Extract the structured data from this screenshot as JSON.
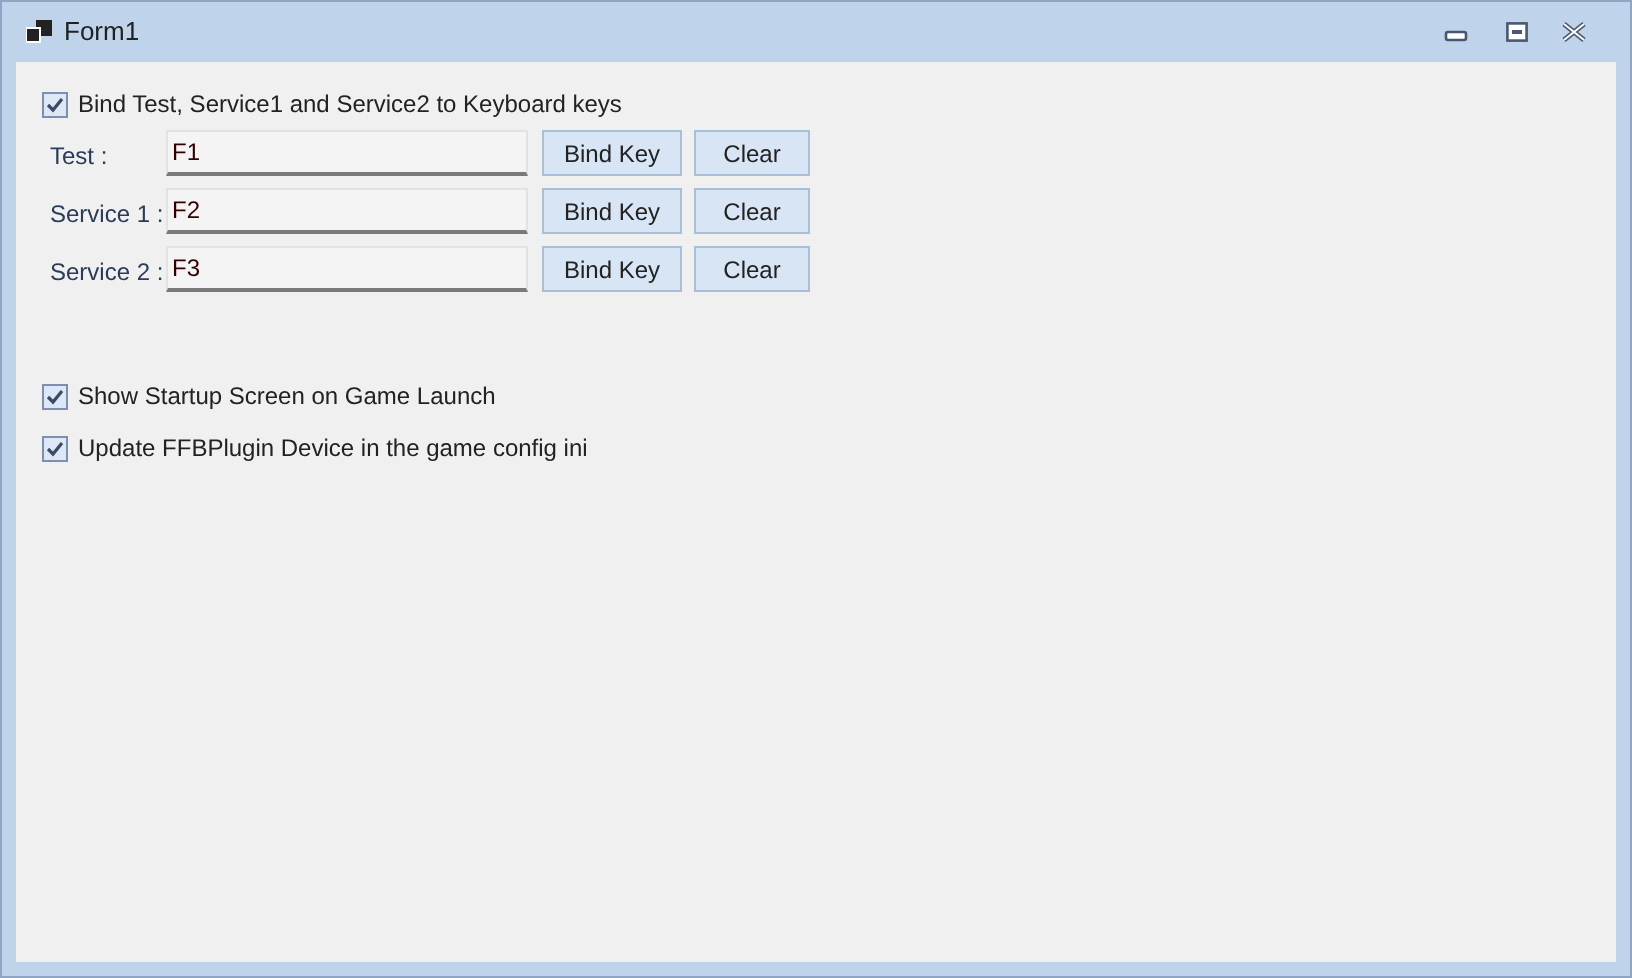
{
  "window": {
    "title": "Form1"
  },
  "bind_option": {
    "label": "Bind Test, Service1 and Service2 to Keyboard keys",
    "checked": true
  },
  "key_rows": [
    {
      "label": "Test :",
      "value": "F1",
      "bind_button": "Bind Key",
      "clear_button": "Clear"
    },
    {
      "label": "Service 1 :",
      "value": "F2",
      "bind_button": "Bind Key",
      "clear_button": "Clear"
    },
    {
      "label": "Service 2 :",
      "value": "F3",
      "bind_button": "Bind Key",
      "clear_button": "Clear"
    }
  ],
  "options": [
    {
      "label": "Show Startup Screen on Game Launch",
      "checked": true
    },
    {
      "label": "Update FFBPlugin Device in the game config ini",
      "checked": true
    }
  ]
}
